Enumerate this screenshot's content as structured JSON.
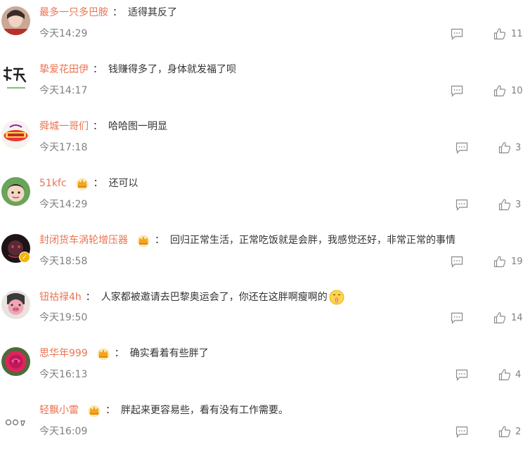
{
  "colors": {
    "username": "#eb7350",
    "text": "#333333",
    "meta": "#808080",
    "badge": "#f5b400"
  },
  "comments": [
    {
      "username": "最多一只多巴胺",
      "badge": false,
      "text": "适得其反了",
      "time": "今天14:29",
      "likes": "11",
      "avatar_icon": "avatar-face-icon"
    },
    {
      "username": "挚爱花田伊",
      "badge": false,
      "text": "钱赚得多了，身体就发福了呗",
      "time": "今天14:17",
      "likes": "10",
      "avatar_icon": "avatar-calligraphy-icon"
    },
    {
      "username": "舜城一哥们",
      "badge": false,
      "text": "哈哈图一明显",
      "time": "今天17:18",
      "likes": "3",
      "avatar_icon": "avatar-logo-icon"
    },
    {
      "username": "51kfc",
      "badge": true,
      "text": "还可以",
      "time": "今天14:29",
      "likes": "3",
      "avatar_icon": "avatar-child-icon"
    },
    {
      "username": "封闭货车涡轮增压器",
      "badge": true,
      "text": "回归正常生活，正常吃饭就是会胖，我感觉还好，非常正常的事情",
      "time": "今天18:58",
      "likes": "19",
      "avatar_icon": "avatar-dark-icon",
      "verified": true
    },
    {
      "username": "钮祜禄4h",
      "badge": false,
      "text": "人家都被邀请去巴黎奥运会了，你还在这胖啊瘦啊的",
      "time": "今天19:50",
      "likes": "14",
      "avatar_icon": "avatar-pig-icon",
      "emoji": "shush-emoji-icon"
    },
    {
      "username": "思华年999",
      "badge": true,
      "text": "确实看着有些胖了",
      "time": "今天16:13",
      "likes": "4",
      "avatar_icon": "avatar-rose-icon"
    },
    {
      "username": "轻飘小雷",
      "badge": true,
      "text": "胖起来更容易些，看有没有工作需要。",
      "time": "今天16:09",
      "likes": "2",
      "avatar_icon": "avatar-sketch-icon"
    }
  ]
}
